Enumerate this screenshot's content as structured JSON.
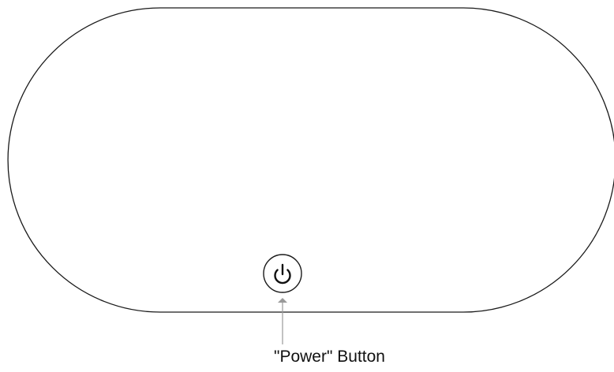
{
  "device": {
    "outline_color": "#1a1a1a",
    "background_color": "#ffffff"
  },
  "power_button": {
    "icon": "power-icon",
    "ring_color": "#1a1a1a"
  },
  "callout": {
    "label": "\"Power\" Button",
    "arrow_color": "#9a9a9a"
  }
}
